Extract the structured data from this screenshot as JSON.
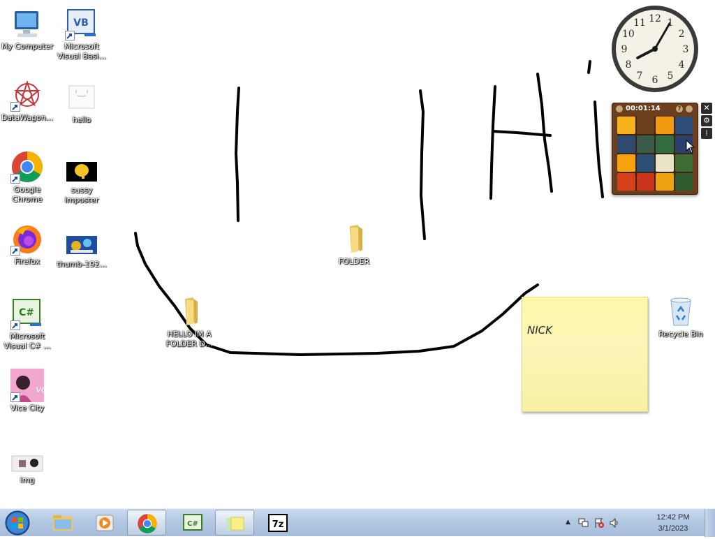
{
  "desktop": {
    "icons_left": [
      {
        "label": "My Computer",
        "icon": "computer-icon"
      },
      {
        "label": "DataWagon...",
        "icon": "datawagon-icon"
      },
      {
        "label": "Google\nChrome",
        "icon": "chrome-icon"
      },
      {
        "label": "Firefox",
        "icon": "firefox-icon"
      },
      {
        "label": "Microsoft\nVisual C# ...",
        "icon": "visual-csharp-icon"
      },
      {
        "label": "Vice City",
        "icon": "vice-city-icon"
      },
      {
        "label": "img",
        "icon": "image-file-icon"
      }
    ],
    "icons_second": [
      {
        "label": "Microsoft\nVisual Basi...",
        "icon": "visual-basic-icon"
      },
      {
        "label": "hello",
        "icon": "text-file-icon"
      },
      {
        "label": "sussy\nimposter",
        "icon": "image-file-icon"
      },
      {
        "label": "thumb-192...",
        "icon": "image-file-icon"
      }
    ],
    "folders": [
      {
        "label": "FOLDER",
        "icon": "folder-icon"
      },
      {
        "label": "HELLO IM A\nFOLDER D...",
        "icon": "folder-icon"
      }
    ],
    "recycle_bin": {
      "label": "Recycle Bin",
      "icon": "recycle-bin-icon"
    }
  },
  "gadgets": {
    "clock": {
      "hour": 8,
      "minute": 5
    },
    "puzzle": {
      "timer": "00:01:14",
      "tiles": [
        "#f7b21c",
        "#6b3f1d",
        "#f29b10",
        "#2c4c7c",
        "#2e4a6e",
        "#3a5a4a",
        "#2f6d3f",
        "#2b3f6e",
        "#f5a20d",
        "#2c4e74",
        "#e9e3c8",
        "#3d6b34",
        "#d8401a",
        "#c9341a",
        "#f0a311",
        "#2f5a2d"
      ]
    },
    "sticky_note": {
      "text": "NICK"
    }
  },
  "taskbar": {
    "start": "start-orb",
    "buttons": [
      {
        "name": "explorer-taskbar-button",
        "icon": "folder-library-icon",
        "active": false
      },
      {
        "name": "media-player-taskbar-button",
        "icon": "media-player-icon",
        "active": false
      },
      {
        "name": "chrome-taskbar-button",
        "icon": "chrome-icon",
        "active": true
      },
      {
        "name": "visual-csharp-taskbar-button",
        "icon": "visual-csharp-icon",
        "active": false
      },
      {
        "name": "sticky-notes-taskbar-button",
        "icon": "sticky-notes-icon",
        "active": true
      },
      {
        "name": "7zip-taskbar-button",
        "icon": "7zip-icon",
        "active": false
      }
    ],
    "tray": {
      "time": "12:42 PM",
      "date": "3/1/2023"
    }
  },
  "colors": {
    "taskbar": "#b3c8e2",
    "sticky": "#fcf5b8",
    "ink": "#000000"
  }
}
